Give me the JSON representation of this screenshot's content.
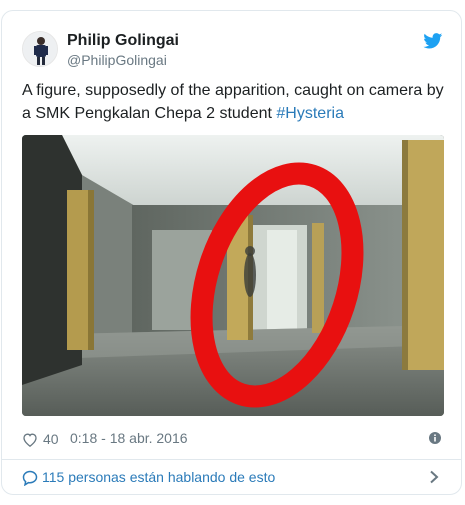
{
  "author": {
    "display_name": "Philip Golingai",
    "screen_name": "@PhilipGolingai",
    "avatar_icon": "person-avatar",
    "brand_icon": "twitter-bird-icon"
  },
  "tweet": {
    "text": "A figure, supposedly of the apparition, caught on camera by a SMK Pengkalan Chepa 2 student ",
    "hashtag": "#Hysteria",
    "media_description_icon": "photo-hallway-with-red-circle"
  },
  "meta": {
    "like_count": "40",
    "timestamp": "0:18 - 18 abr. 2016",
    "like_icon": "heart-icon",
    "info_icon": "info-icon"
  },
  "conversation": {
    "label": "115 personas están hablando de esto",
    "icon": "speech-bubble-icon",
    "chevron_icon": "chevron-right-icon"
  },
  "colors": {
    "link": "#2b7bb9",
    "text": "#1c2022",
    "muted": "#697882",
    "border": "#e1e8ed",
    "twitter_blue": "#1da1f2",
    "circle_red": "#e81010"
  }
}
